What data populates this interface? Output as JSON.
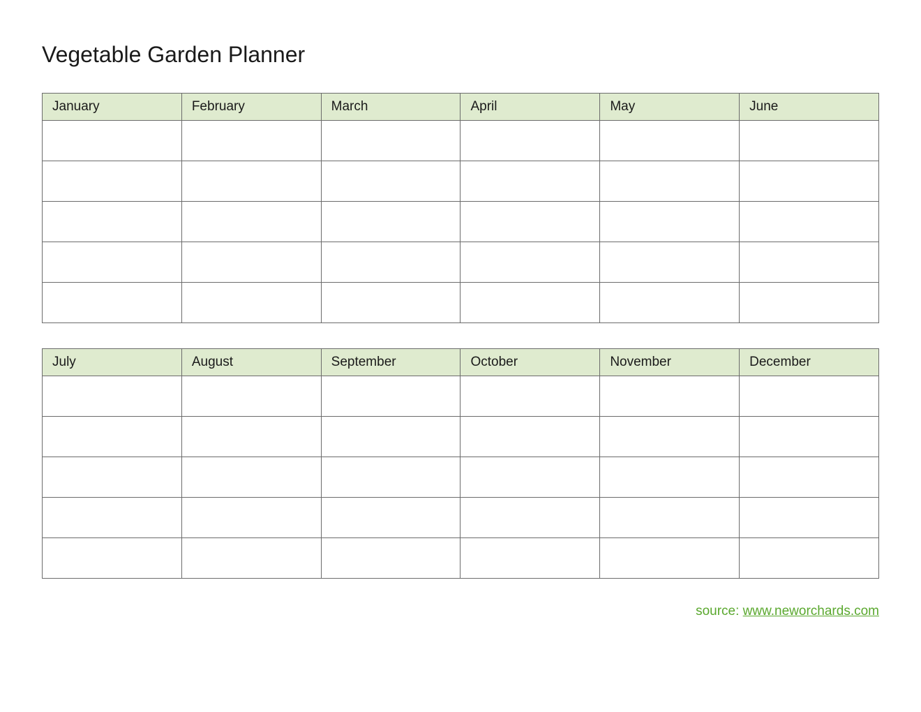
{
  "title": "Vegetable Garden Planner",
  "tables": {
    "first_half": {
      "headers": [
        "January",
        "February",
        "March",
        "April",
        "May",
        "June"
      ],
      "rows": 5
    },
    "second_half": {
      "headers": [
        "July",
        "August",
        "September",
        "October",
        "November",
        "December"
      ],
      "rows": 5
    }
  },
  "footer": {
    "label": "source: ",
    "link_text": "www.neworchards.com"
  },
  "colors": {
    "header_bg": "#dfebcf",
    "border": "#6b6b6b",
    "footer_text": "#5aa82e"
  }
}
